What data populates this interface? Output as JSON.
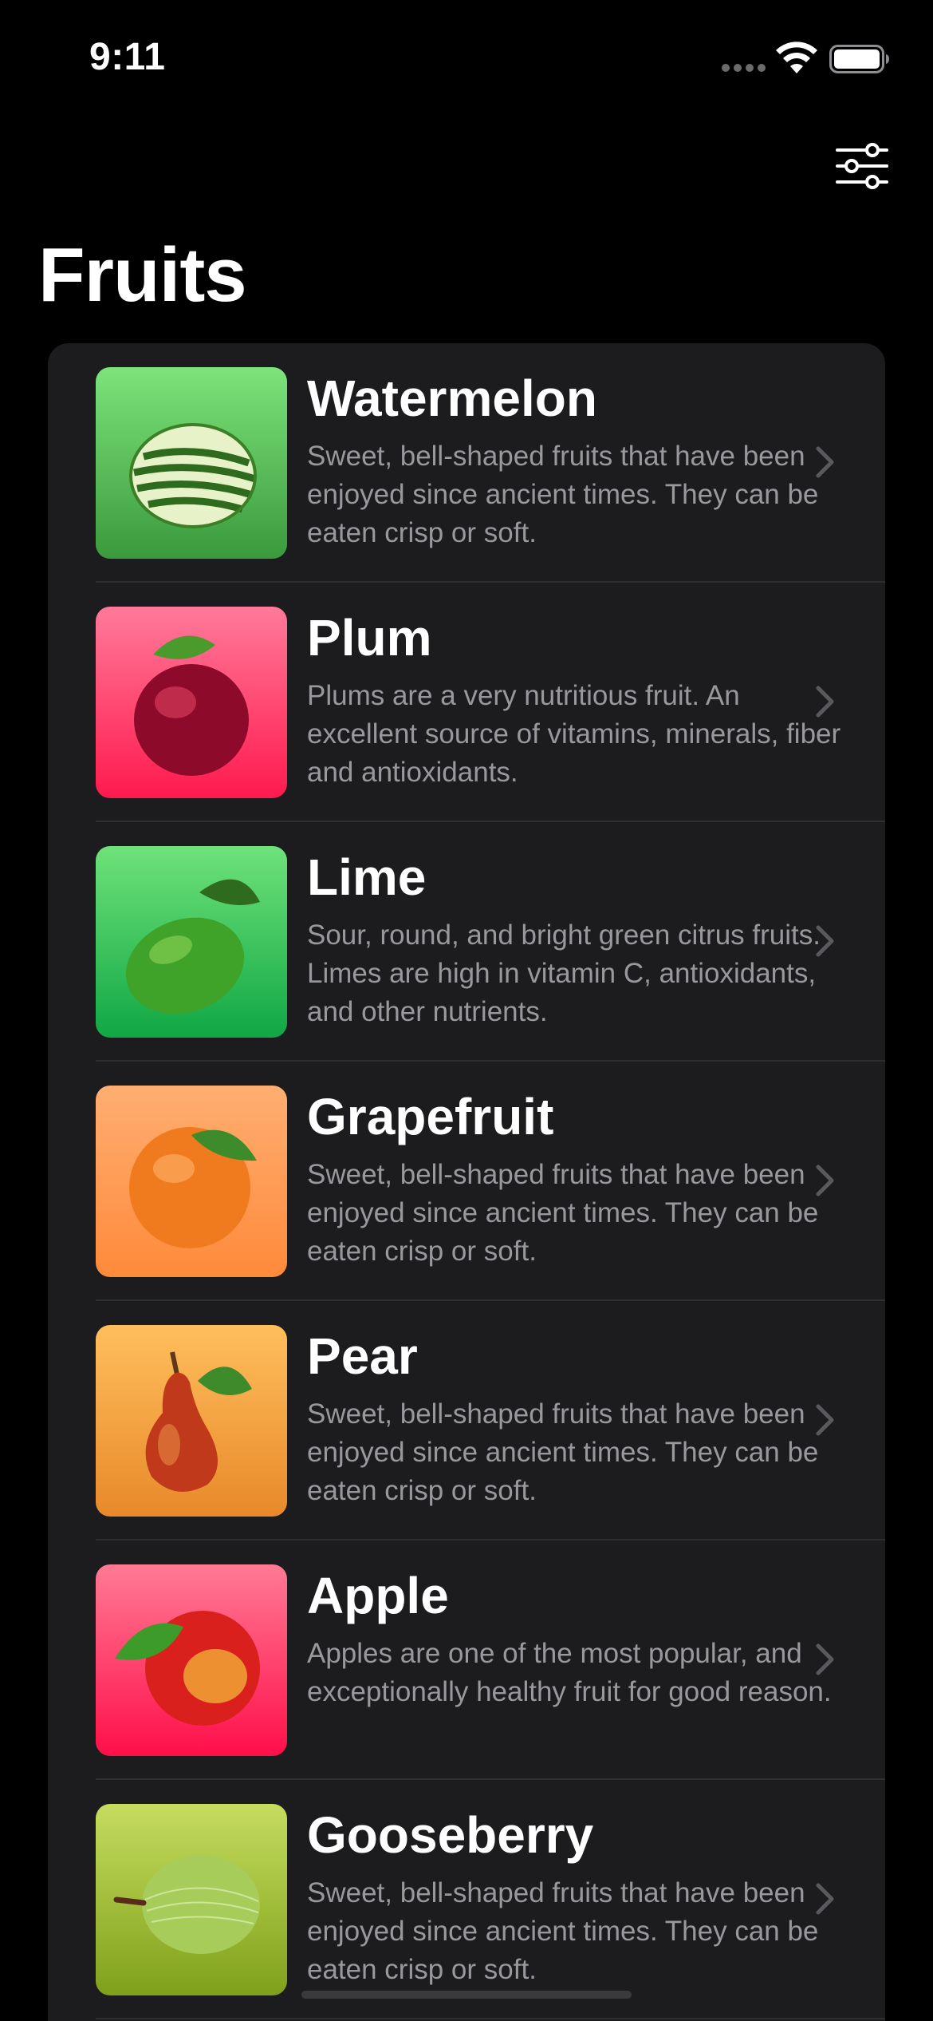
{
  "status_bar": {
    "time": "9:11"
  },
  "nav": {
    "title": "Fruits",
    "filter_icon": "sliders-icon"
  },
  "colors": {
    "background": "#000000",
    "card": "#1c1c1e",
    "secondary_text": "#98989d",
    "chevron": "#5a5a5e"
  },
  "fruits": [
    {
      "name": "Watermelon",
      "description": "Sweet, bell-shaped fruits that have been enjoyed since ancient times. They can be eaten crisp or soft.",
      "gradient": [
        "#7de37a",
        "#3a9a3c"
      ],
      "icon": "watermelon-icon"
    },
    {
      "name": "Plum",
      "description": "Plums are a very nutritious fruit. An excellent source of vitamins, minerals, fiber and antioxidants.",
      "gradient": [
        "#ff7a9a",
        "#ff1a4e"
      ],
      "icon": "plum-icon"
    },
    {
      "name": "Lime",
      "description": "Sour, round, and bright green citrus fruits. Limes are high in vitamin C, antioxidants, and other nutrients.",
      "gradient": [
        "#6fe27a",
        "#10a745"
      ],
      "icon": "lime-icon"
    },
    {
      "name": "Grapefruit",
      "description": "Sweet, bell-shaped fruits that have been enjoyed since ancient times. They can be eaten crisp or soft.",
      "gradient": [
        "#ffae72",
        "#ff8a3a"
      ],
      "icon": "grapefruit-icon"
    },
    {
      "name": "Pear",
      "description": "Sweet, bell-shaped fruits that have been enjoyed since ancient times. They can be eaten crisp or soft.",
      "gradient": [
        "#ffbe5c",
        "#e8892a"
      ],
      "icon": "pear-icon"
    },
    {
      "name": "Apple",
      "description": "Apples are one of the most popular, and exceptionally healthy fruit for good reason.",
      "gradient": [
        "#ff7a95",
        "#ff0f4a"
      ],
      "icon": "apple-icon"
    },
    {
      "name": "Gooseberry",
      "description": "Sweet, bell-shaped fruits that have been enjoyed since ancient times. They can be eaten crisp or soft.",
      "gradient": [
        "#c6dc5e",
        "#7ea11a"
      ],
      "icon": "gooseberry-icon"
    }
  ]
}
